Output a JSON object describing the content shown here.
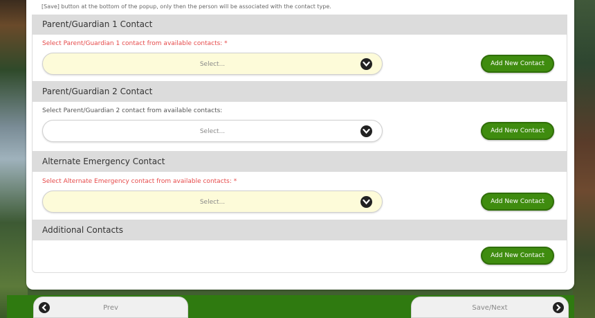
{
  "intro_text": "[Save] button at the bottom of the popup, only then the person will be associated with the contact type.",
  "sections": [
    {
      "title": "Parent/Guardian 1 Contact",
      "label": "Select Parent/Guardian 1 contact from available contacts: *",
      "select_value": "Select...",
      "button": "Add New Contact"
    },
    {
      "title": "Parent/Guardian 2 Contact",
      "label": "Select Parent/Guardian 2 contact from available contacts:",
      "select_value": "Select...",
      "button": "Add New Contact"
    },
    {
      "title": "Alternate Emergency Contact",
      "label": "Select Alternate Emergency contact from available contacts: *",
      "select_value": "Select...",
      "button": "Add New Contact"
    },
    {
      "title": "Additional Contacts",
      "button": "Add New Contact"
    }
  ],
  "footer": {
    "prev_label": "Prev",
    "next_label": "Save/Next"
  },
  "colors": {
    "required_label": "#e64a4a",
    "button_green": "#3f8c0f",
    "required_select_bg": "#fdfbd9",
    "footer_green": "#2f7a10"
  },
  "icons": {
    "select_chevron": "chevron-down-icon",
    "prev": "arrow-left-icon",
    "next": "arrow-right-icon"
  }
}
